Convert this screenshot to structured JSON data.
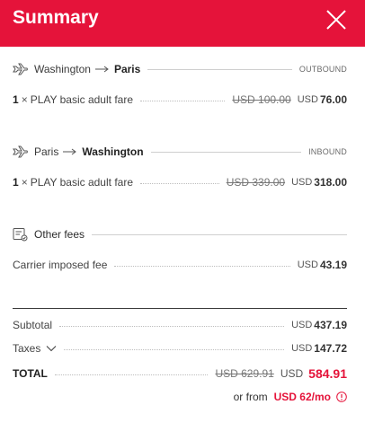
{
  "header": {
    "title": "Summary"
  },
  "outbound": {
    "from": "Washington",
    "to": "Paris",
    "tag": "OUTBOUND",
    "fare": {
      "qty": "1",
      "times": "×",
      "label": "PLAY basic adult fare",
      "old_price": "USD 100.00",
      "currency": "USD",
      "price": "76.00"
    }
  },
  "inbound": {
    "from": "Paris",
    "to": "Washington",
    "tag": "INBOUND",
    "fare": {
      "qty": "1",
      "times": "×",
      "label": "PLAY basic adult fare",
      "old_price": "USD 339.00",
      "currency": "USD",
      "price": "318.00"
    }
  },
  "fees": {
    "title": "Other fees",
    "items": [
      {
        "label": "Carrier imposed fee",
        "currency": "USD",
        "price": "43.19"
      }
    ]
  },
  "totals": {
    "subtotal_label": "Subtotal",
    "subtotal_currency": "USD",
    "subtotal": "437.19",
    "taxes_label": "Taxes",
    "taxes_currency": "USD",
    "taxes": "147.72",
    "total_label": "TOTAL",
    "total_old": "USD 629.91",
    "total_currency": "USD",
    "total": "584.91"
  },
  "financing": {
    "label": "or from",
    "amount": "USD 62/mo"
  },
  "colors": {
    "brand": "#e5133a"
  },
  "icons": {
    "close": "close-icon",
    "plane": "plane-icon",
    "arrow": "arrow-right-icon",
    "fees": "receipt-icon",
    "chevron": "chevron-down-icon",
    "info": "info-icon"
  }
}
